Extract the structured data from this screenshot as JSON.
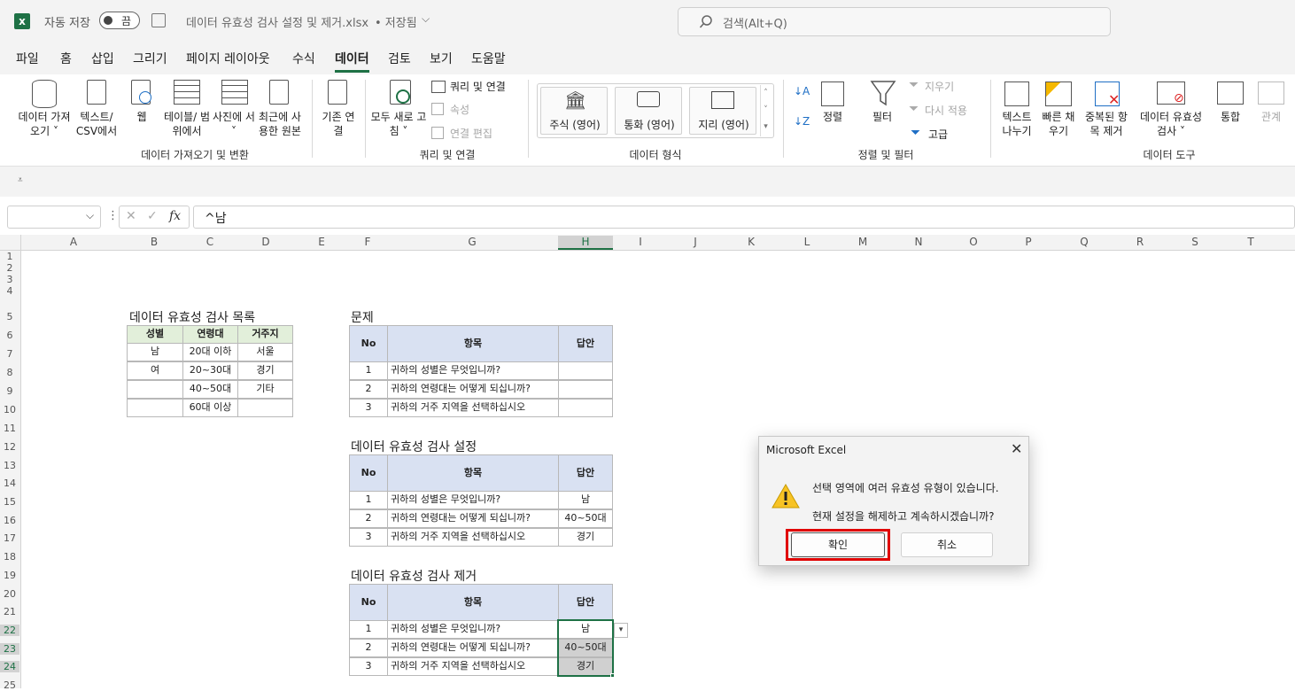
{
  "app": {
    "autosave_label": "자동 저장",
    "toggle_label": "끔",
    "filename": "데이터 유효성 검사 설정 및 제거.xlsx",
    "saved_status": "• 저장됨",
    "search_placeholder": "검색(Alt+Q)"
  },
  "menu": [
    "파일",
    "홈",
    "삽입",
    "그리기",
    "페이지 레이아웃",
    "수식",
    "데이터",
    "검토",
    "보기",
    "도움말"
  ],
  "ribbon": {
    "get_data": "데이터 가져오기 ˅",
    "from_text": "텍스트/ CSV에서",
    "web": "웹",
    "table": "테이블/ 범위에서",
    "picture": "사진에 서 ˅",
    "recent": "최근에 사 용한 원본",
    "existing": "기존 연결",
    "group_get": "데이터 가져오기 및 변환",
    "refresh": "모두 새로 고침 ˅",
    "queries": "쿼리 및 연결",
    "properties": "속성",
    "edit_links": "연결 편집",
    "group_queries": "쿼리 및 연결",
    "stocks": "주식 (영어)",
    "currencies": "통화 (영어)",
    "geography": "지리 (영어)",
    "group_types": "데이터 형식",
    "sort": "정렬",
    "filter": "필터",
    "clear": "지우기",
    "reapply": "다시 적용",
    "advanced": "고급",
    "group_sort": "정렬 및 필터",
    "text_columns": "텍스트 나누기",
    "flash_fill": "빠른 채우기",
    "remove_dup": "중복된 항목 제거",
    "validation": "데이터 유효성 검사 ˅",
    "consolidate": "통합",
    "relationships": "관계",
    "group_tools": "데이터 도구"
  },
  "formula": {
    "namebox": "",
    "fx": "fx",
    "content": "^남"
  },
  "columns": [
    "A",
    "B",
    "C",
    "D",
    "E",
    "F",
    "G",
    "H",
    "I",
    "J",
    "K",
    "L",
    "M",
    "N",
    "O",
    "P",
    "Q",
    "R",
    "S",
    "T"
  ],
  "rows": [
    "1",
    "2",
    "3",
    "4",
    "5",
    "6",
    "7",
    "8",
    "9",
    "10",
    "11",
    "12",
    "13",
    "14",
    "15",
    "16",
    "17",
    "18",
    "19",
    "20",
    "21",
    "22",
    "23",
    "24",
    "25"
  ],
  "list": {
    "title": "데이터 유효성 검사 목록",
    "headers": [
      "성별",
      "연령대",
      "거주지"
    ],
    "rows": [
      [
        "남",
        "20대 이하",
        "서울"
      ],
      [
        "여",
        "20~30대",
        "경기"
      ],
      [
        "",
        "40~50대",
        "기타"
      ],
      [
        "",
        "60대 이상",
        ""
      ]
    ]
  },
  "tables": [
    {
      "title": "문제",
      "headers": [
        "No",
        "항목",
        "답안"
      ],
      "rows": [
        [
          "1",
          "귀하의 성별은 무엇입니까?",
          ""
        ],
        [
          "2",
          "귀하의 연령대는 어떻게 되십니까?",
          ""
        ],
        [
          "3",
          "귀하의 거주 지역을 선택하십시오",
          ""
        ]
      ]
    },
    {
      "title": "데이터 유효성 검사 설정",
      "headers": [
        "No",
        "항목",
        "답안"
      ],
      "rows": [
        [
          "1",
          "귀하의 성별은 무엇입니까?",
          "남"
        ],
        [
          "2",
          "귀하의 연령대는 어떻게 되십니까?",
          "40~50대"
        ],
        [
          "3",
          "귀하의 거주 지역을 선택하십시오",
          "경기"
        ]
      ]
    },
    {
      "title": "데이터 유효성 검사 제거",
      "headers": [
        "No",
        "항목",
        "답안"
      ],
      "rows": [
        [
          "1",
          "귀하의 성별은 무엇입니까?",
          "남"
        ],
        [
          "2",
          "귀하의 연령대는 어떻게 되십니까?",
          "40~50대"
        ],
        [
          "3",
          "귀하의 거주 지역을 선택하십시오",
          "경기"
        ]
      ]
    }
  ],
  "dialog": {
    "title": "Microsoft Excel",
    "line1": "선택 영역에 여러 유효성 유형이 있습니다.",
    "line2": "현재 설정을 해제하고 계속하시겠습니까?",
    "ok": "확인",
    "cancel": "취소"
  },
  "colors": {
    "excel_green": "#1e7145",
    "highlight": "#e00000"
  }
}
